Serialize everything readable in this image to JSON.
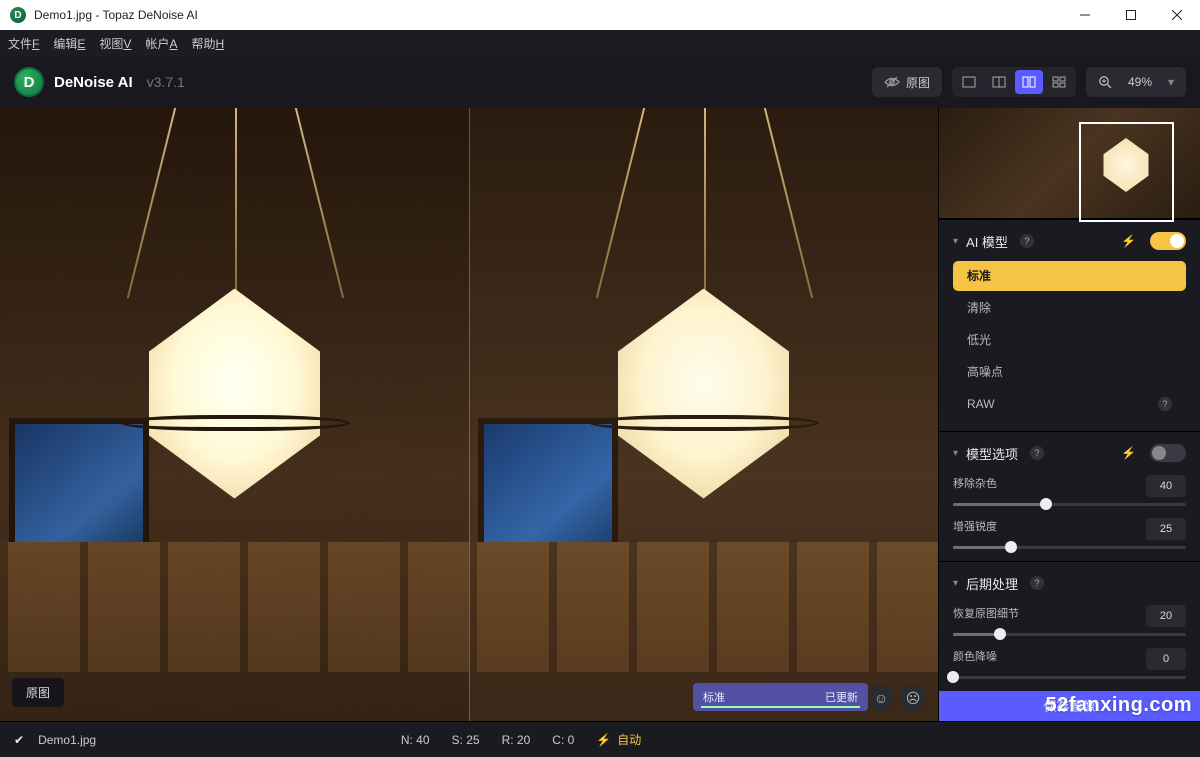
{
  "window": {
    "title": "Demo1.jpg - Topaz DeNoise AI"
  },
  "menubar": {
    "file": "文件",
    "file_u": "F",
    "edit": "编辑",
    "edit_u": "E",
    "view": "视图",
    "view_u": "V",
    "account": "帐户",
    "account_u": "A",
    "help": "帮助",
    "help_u": "H"
  },
  "brand": {
    "name": "DeNoise AI",
    "version": "v3.7.1",
    "logo_letter": "D"
  },
  "toolbar": {
    "original_btn": "原图",
    "zoom": "49%"
  },
  "canvas": {
    "original_badge": "原图",
    "status_model": "标准",
    "status_text": "已更新"
  },
  "panels": {
    "ai_model": {
      "title": "AI 模型",
      "items": {
        "standard": "标准",
        "clear": "清除",
        "low_light": "低光",
        "high_noise": "高噪点",
        "raw": "RAW"
      }
    },
    "model_opts": {
      "title": "模型选项",
      "remove_noise": {
        "label": "移除杂色",
        "value": "40"
      },
      "enhance_sharp": {
        "label": "增强锐度",
        "value": "25"
      }
    },
    "post": {
      "title": "后期处理",
      "recover_detail": {
        "label": "恢复原图细节",
        "value": "20"
      },
      "color_noise": {
        "label": "颜色降噪",
        "value": "0"
      }
    }
  },
  "footer": {
    "filename": "Demo1.jpg",
    "N_label": "N:",
    "N": "40",
    "S_label": "S:",
    "S": "25",
    "R_label": "R:",
    "R": "20",
    "C_label": "C:",
    "C": "0",
    "auto": "自动"
  },
  "save_button": "保存图像",
  "watermark": "52fanxing.com"
}
